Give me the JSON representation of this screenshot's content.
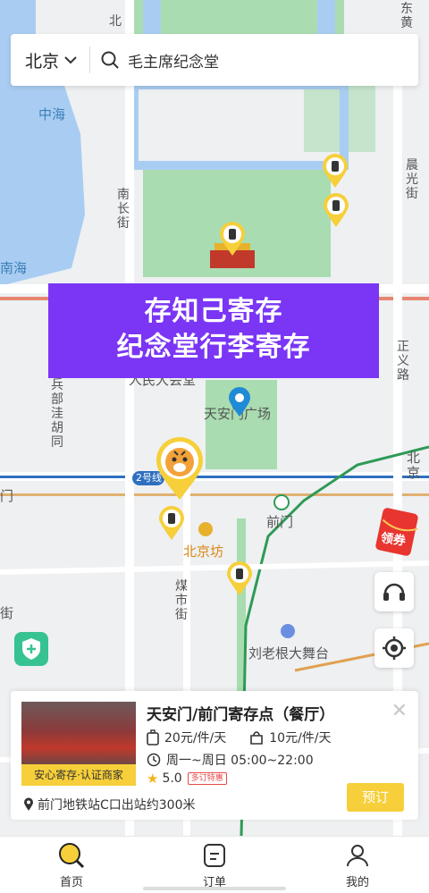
{
  "search": {
    "city": "北京",
    "query": "毛主席纪念堂"
  },
  "map": {
    "labels": {
      "zhonghai": "中海",
      "nanhai": "南海",
      "nanchangjie": "南长街",
      "chenguangjie": "晨光街",
      "dongjie": "东黄",
      "bei": "北",
      "renmin": "人民大会堂",
      "tiananmen_square": "天安门广场",
      "bingbu": "兵部洼胡同",
      "zhengyi": "正义路",
      "line2": "2号线",
      "qianmen": "前门",
      "beijingfang": "北京坊",
      "meishi": "煤市街",
      "liulaogen": "刘老根大舞台",
      "bei_right": "北京",
      "jie_left": "街",
      "men_left": "门"
    }
  },
  "banner": {
    "line1": "存知己寄存",
    "line2": "纪念堂行李寄存"
  },
  "coupon": {
    "label": "领券"
  },
  "card": {
    "thumb_label": "安心寄存·认证商家",
    "title": "天安门/前门寄存点（餐厅）",
    "large_price": "20元/件/天",
    "small_price": "10元/件/天",
    "hours": "周一~周日 05:00~22:00",
    "discount_tag": "多订特惠",
    "rating": "5.0",
    "address": "前门地铁站C口出站约300米",
    "book_label": "预订"
  },
  "tabs": [
    {
      "label": "首页",
      "icon": "search-icon"
    },
    {
      "label": "订单",
      "icon": "order-icon"
    },
    {
      "label": "我的",
      "icon": "user-icon"
    }
  ],
  "colors": {
    "banner": "#7a35f5",
    "accent": "#f6cf3a",
    "water": "#a9cdf2",
    "park": "#a9dcb0"
  }
}
